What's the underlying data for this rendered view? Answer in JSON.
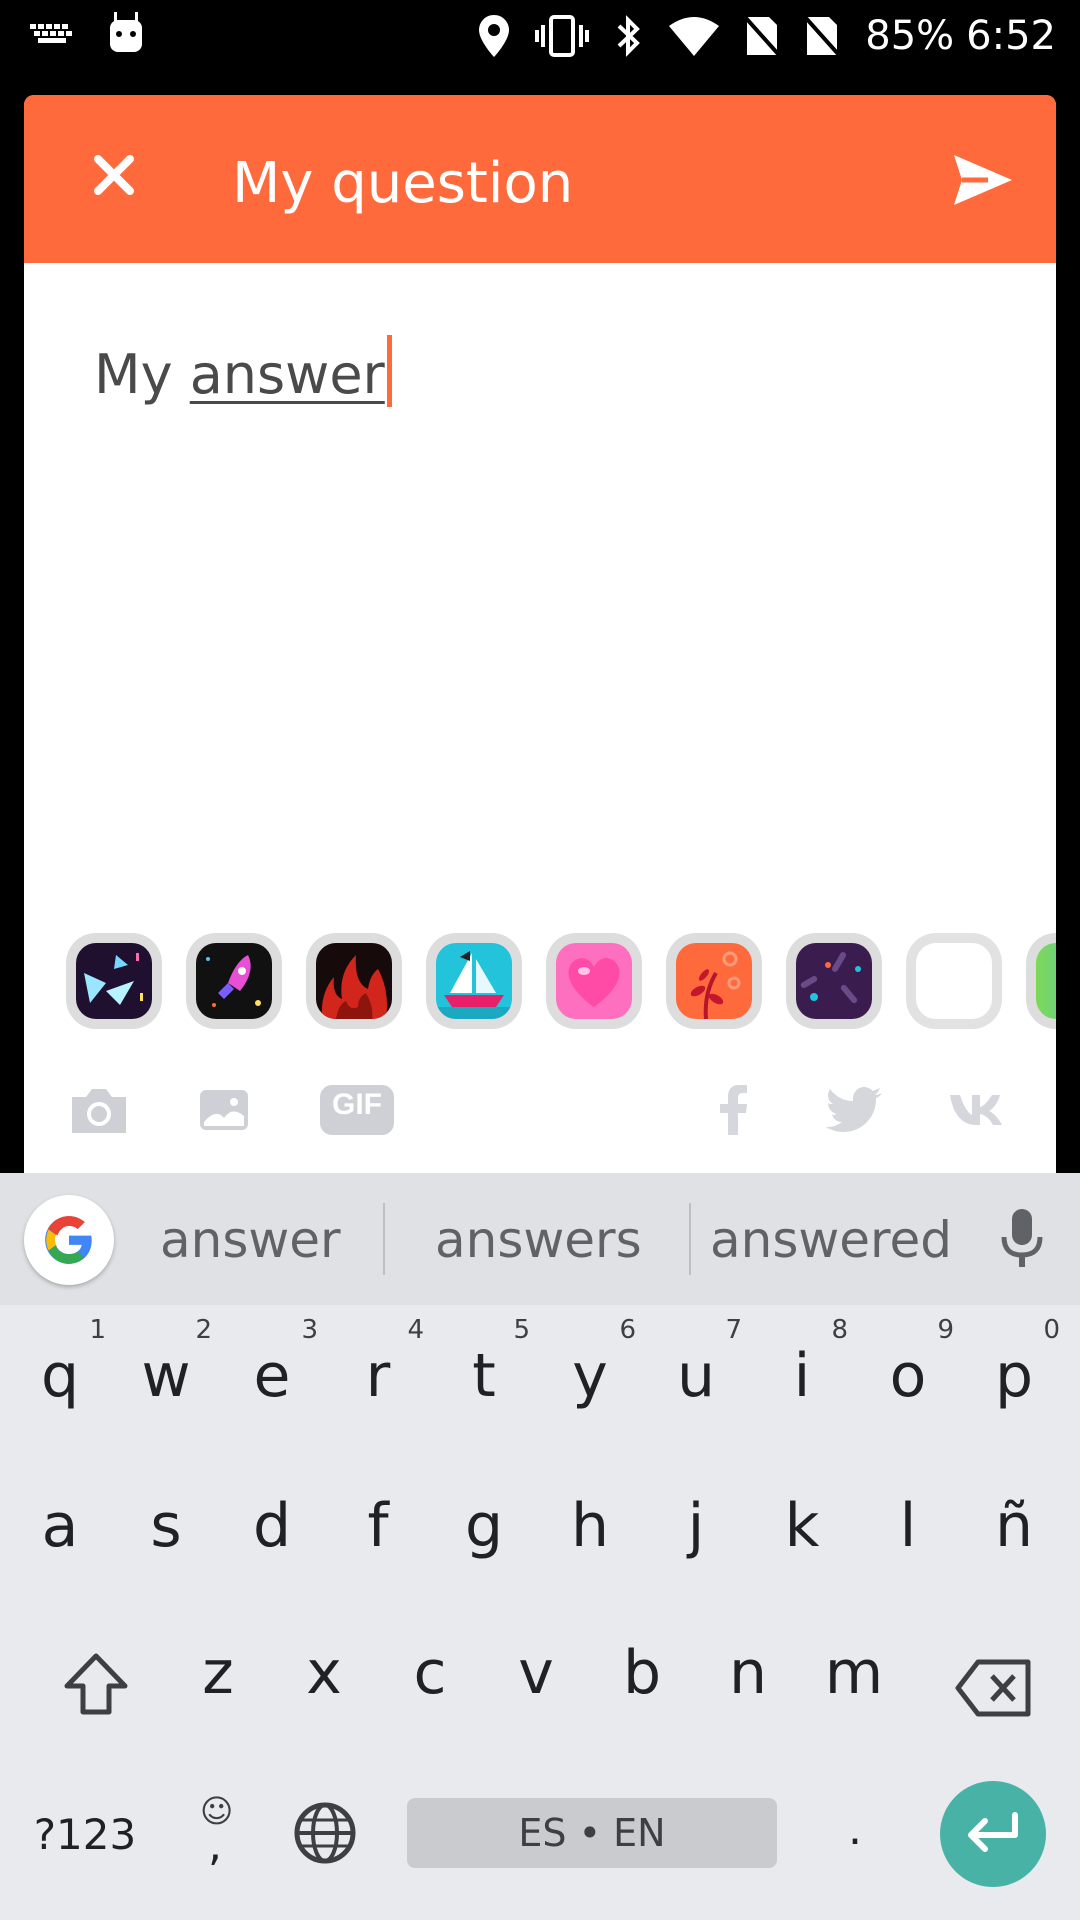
{
  "statusbar": {
    "battery": "85%",
    "time": "6:52"
  },
  "header": {
    "title": "My question"
  },
  "answer": {
    "prefix": "My ",
    "underlined": "answer"
  },
  "themes": [
    "confetti",
    "rocket",
    "fire",
    "sailboat",
    "heart",
    "flowers",
    "sprinkles",
    "blank",
    "gradient"
  ],
  "tools": {
    "gif_label": "GIF"
  },
  "suggestions": [
    "answer",
    "answers",
    "answered"
  ],
  "keys": {
    "row1": [
      {
        "ch": "q",
        "hint": "1"
      },
      {
        "ch": "w",
        "hint": "2"
      },
      {
        "ch": "e",
        "hint": "3"
      },
      {
        "ch": "r",
        "hint": "4"
      },
      {
        "ch": "t",
        "hint": "5"
      },
      {
        "ch": "y",
        "hint": "6"
      },
      {
        "ch": "u",
        "hint": "7"
      },
      {
        "ch": "i",
        "hint": "8"
      },
      {
        "ch": "o",
        "hint": "9"
      },
      {
        "ch": "p",
        "hint": "0"
      }
    ],
    "row2": [
      "a",
      "s",
      "d",
      "f",
      "g",
      "h",
      "j",
      "k",
      "l",
      "ñ"
    ],
    "row3": [
      "z",
      "x",
      "c",
      "v",
      "b",
      "n",
      "m"
    ],
    "symbols": "?123",
    "comma": ",",
    "period": ".",
    "space": "ES • EN"
  },
  "colors": {
    "accent": "#ff6a3c",
    "enter": "#48b2a7"
  }
}
